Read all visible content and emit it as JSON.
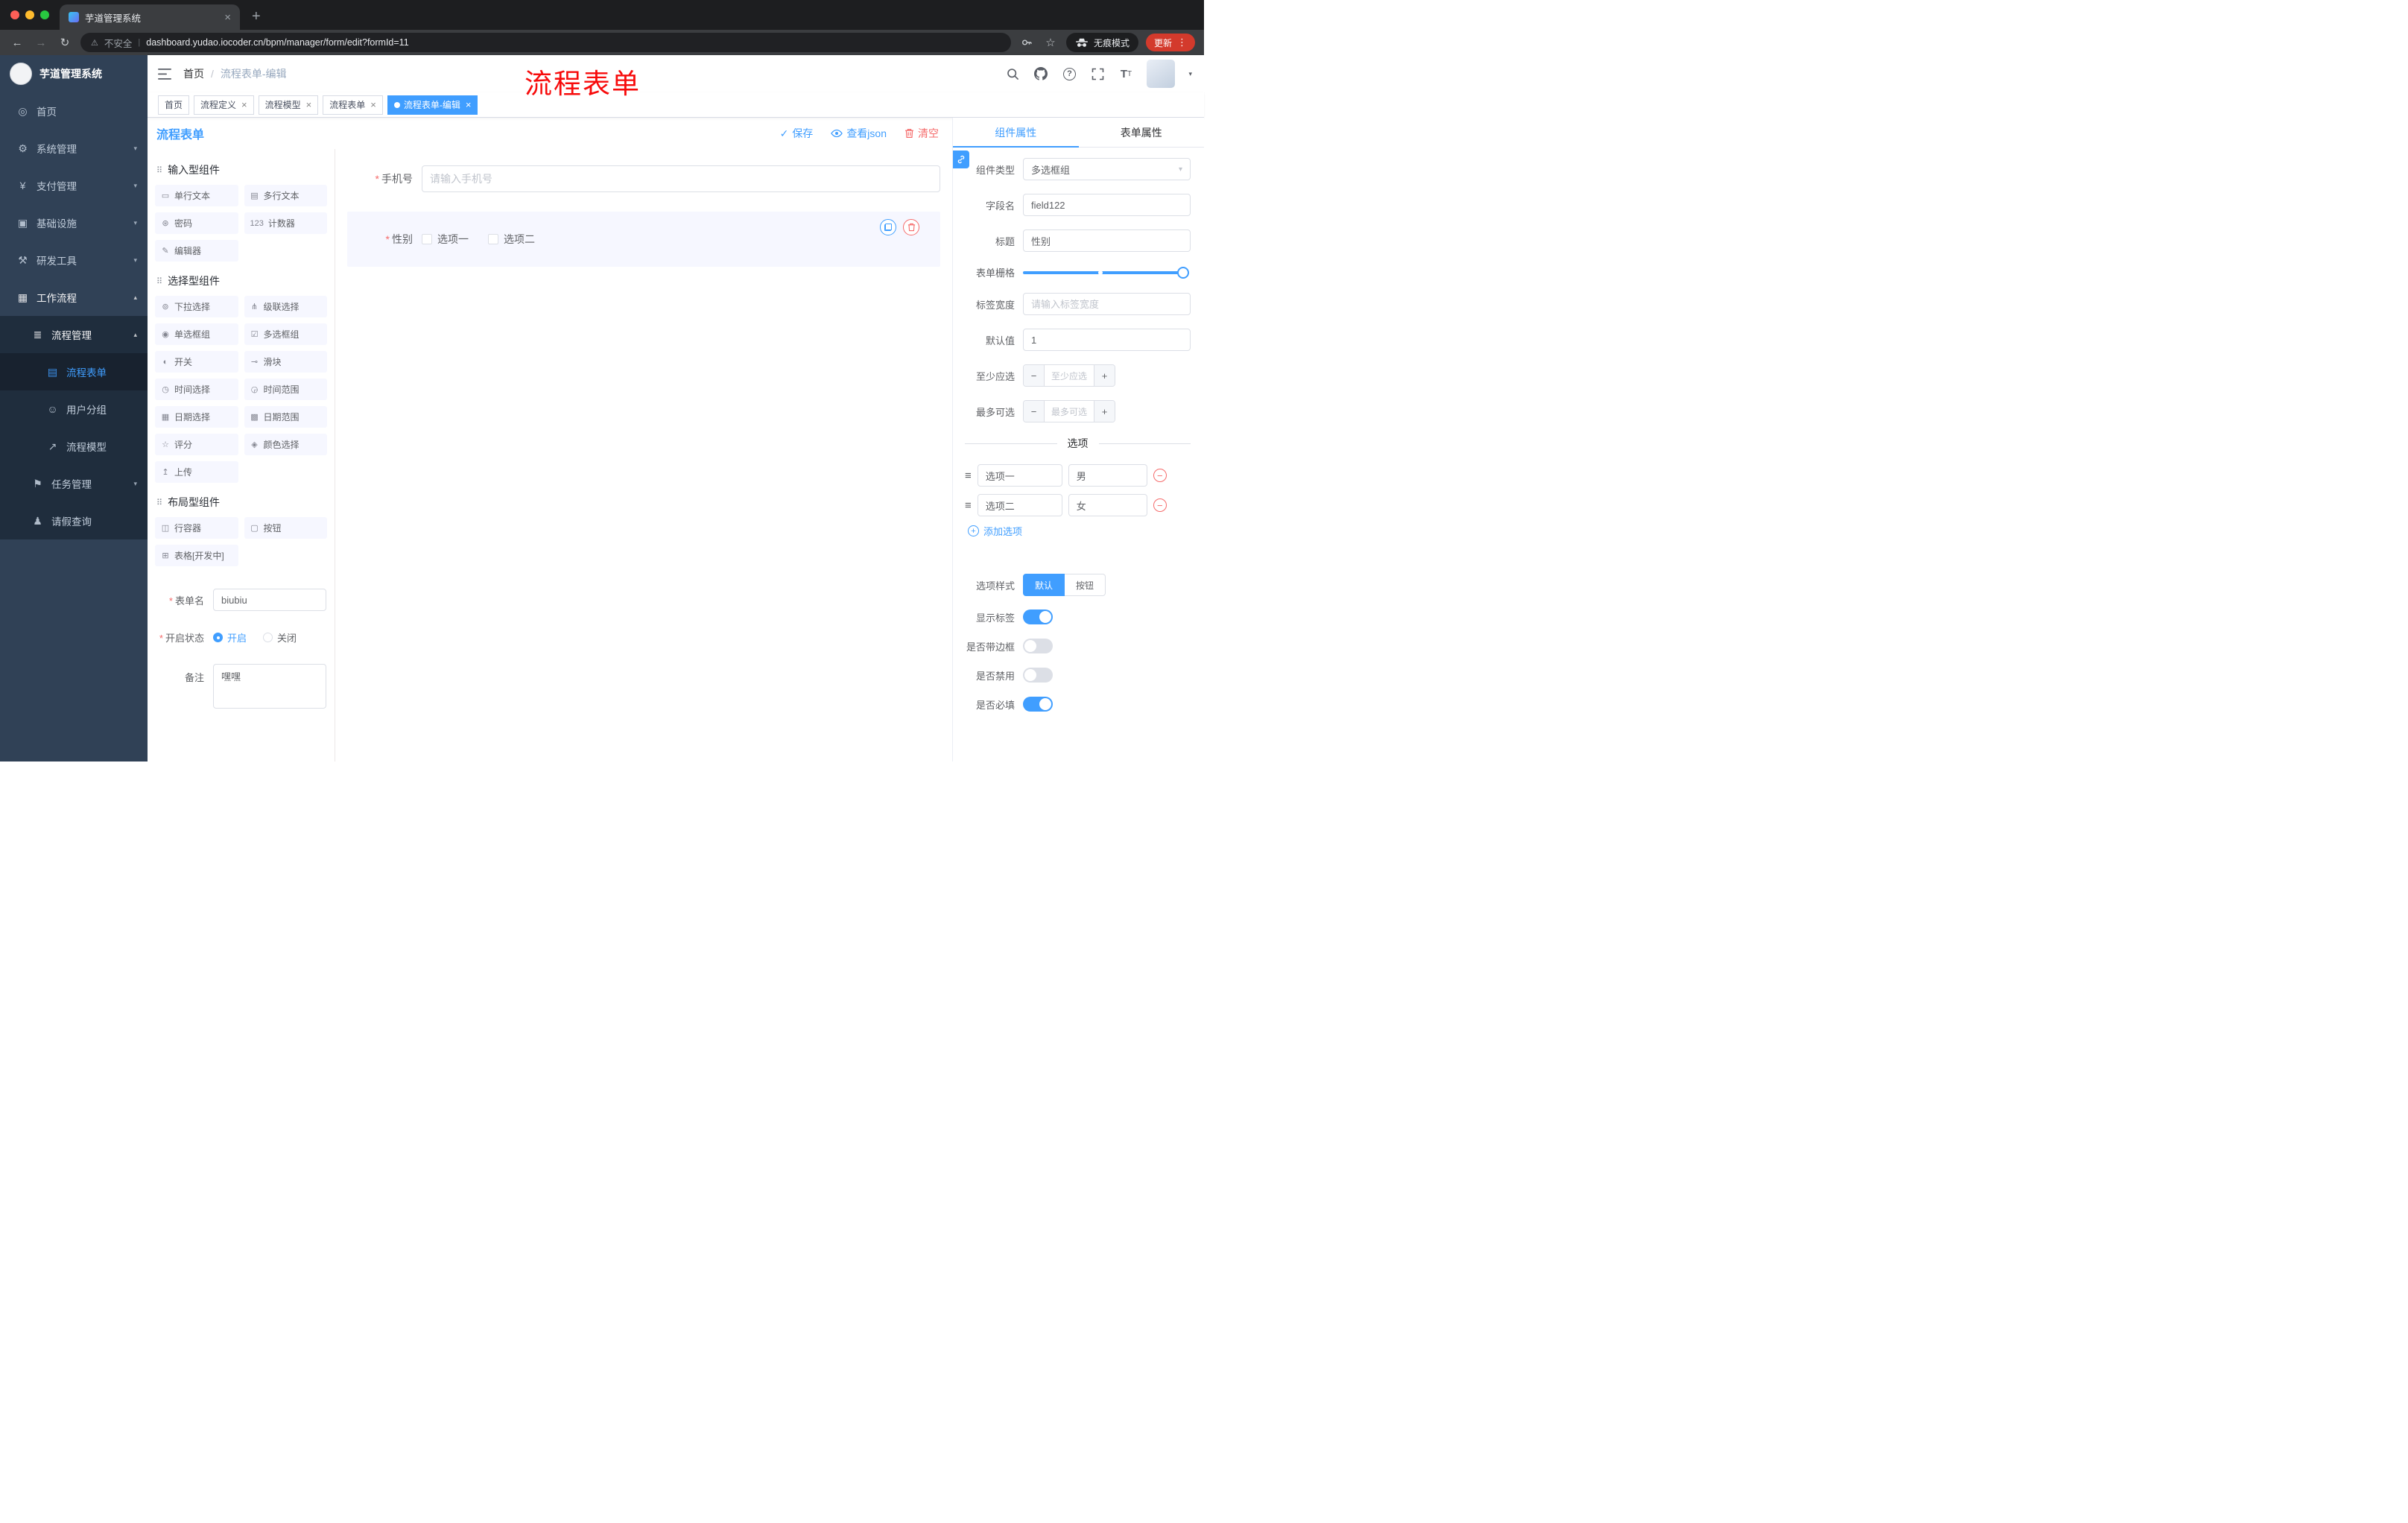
{
  "colors": {
    "primary": "#409eff",
    "danger": "#f56c6c",
    "annotation": "#f70b0b",
    "sidebar-bg": "#304156",
    "submenu-bg": "#1f2d3d",
    "update-badge": "#d33a2c"
  },
  "browser": {
    "tab_title": "芋道管理系统",
    "security_label": "不安全",
    "url": "dashboard.yudao.iocoder.cn/bpm/manager/form/edit?formId=11",
    "incognito_label": "无痕模式",
    "update_label": "更新"
  },
  "sidebar": {
    "logo_title": "芋道管理系统",
    "items": [
      {
        "label": "首页",
        "icon": "home-icon",
        "glyph": "◎",
        "level": 1
      },
      {
        "label": "系统管理",
        "icon": "gear-icon",
        "glyph": "⚙",
        "level": 1,
        "arrow": "▾"
      },
      {
        "label": "支付管理",
        "icon": "payment-icon",
        "glyph": "¥",
        "level": 1,
        "arrow": "▾"
      },
      {
        "label": "基础设施",
        "icon": "infrastructure-icon",
        "glyph": "▣",
        "level": 1,
        "arrow": "▾"
      },
      {
        "label": "研发工具",
        "icon": "dev-tools-icon",
        "glyph": "⚒",
        "level": 1,
        "arrow": "▾"
      },
      {
        "label": "工作流程",
        "icon": "workflow-icon",
        "glyph": "▦",
        "level": 1,
        "arrow": "▴",
        "open": true
      },
      {
        "label": "流程管理",
        "icon": "process-management-icon",
        "glyph": "≣",
        "level": 2,
        "arrow": "▴",
        "open": true,
        "sub": true
      },
      {
        "label": "流程表单",
        "icon": "process-form-icon",
        "glyph": "▤",
        "level": 3,
        "active": true,
        "sub": true
      },
      {
        "label": "用户分组",
        "icon": "user-group-icon",
        "glyph": "☺",
        "level": 3,
        "sub": true
      },
      {
        "label": "流程模型",
        "icon": "process-model-icon",
        "glyph": "↗",
        "level": 3,
        "sub": true
      },
      {
        "label": "任务管理",
        "icon": "task-management-icon",
        "glyph": "⚑",
        "level": 2,
        "arrow": "▾",
        "sub": true
      },
      {
        "label": "请假查询",
        "icon": "leave-query-icon",
        "glyph": "♟",
        "level": 2,
        "sub": true
      }
    ]
  },
  "header": {
    "breadcrumb": [
      "首页",
      "流程表单-编辑"
    ],
    "breadcrumb_sep": "/",
    "annotation": "流程表单"
  },
  "tags": [
    {
      "label": "首页"
    },
    {
      "label": "流程定义",
      "closable": true
    },
    {
      "label": "流程模型",
      "closable": true
    },
    {
      "label": "流程表单",
      "closable": true
    },
    {
      "label": "流程表单-编辑",
      "closable": true,
      "active": true
    }
  ],
  "designer": {
    "panel_title": "流程表单",
    "toolbar": [
      {
        "label": "保存",
        "icon": "check-icon"
      },
      {
        "label": "查看json",
        "icon": "eye-icon"
      },
      {
        "label": "清空",
        "icon": "trash-icon"
      }
    ],
    "palette": {
      "group_icon": "⠿",
      "groups": [
        {
          "title": "输入型组件",
          "items": [
            {
              "label": "单行文本",
              "icon": "single-line-text-icon",
              "glyph": "▭"
            },
            {
              "label": "多行文本",
              "icon": "multi-line-text-icon",
              "glyph": "▤"
            },
            {
              "label": "密码",
              "icon": "password-lock-icon",
              "glyph": "⊛"
            },
            {
              "label": "计数器",
              "icon": "counter-icon",
              "glyph": "123"
            },
            {
              "label": "编辑器",
              "icon": "editor-icon",
              "glyph": "✎"
            }
          ]
        },
        {
          "title": "选择型组件",
          "items": [
            {
              "label": "下拉选择",
              "icon": "select-icon",
              "glyph": "⊚"
            },
            {
              "label": "级联选择",
              "icon": "cascader-icon",
              "glyph": "⋔"
            },
            {
              "label": "单选框组",
              "icon": "radio-group-icon",
              "glyph": "◉"
            },
            {
              "label": "多选框组",
              "icon": "checkbox-group-icon",
              "glyph": "☑"
            },
            {
              "label": "开关",
              "icon": "switch-icon",
              "glyph": "◐"
            },
            {
              "label": "滑块",
              "icon": "slider-icon",
              "glyph": "⊸"
            },
            {
              "label": "时间选择",
              "icon": "time-picker-icon",
              "glyph": "◷"
            },
            {
              "label": "时间范围",
              "icon": "time-range-icon",
              "glyph": "◶"
            },
            {
              "label": "日期选择",
              "icon": "date-picker-icon",
              "glyph": "▦"
            },
            {
              "label": "日期范围",
              "icon": "date-range-icon",
              "glyph": "▩"
            },
            {
              "label": "评分",
              "icon": "rate-icon",
              "glyph": "☆"
            },
            {
              "label": "颜色选择",
              "icon": "color-picker-icon",
              "glyph": "◈"
            },
            {
              "label": "上传",
              "icon": "upload-icon",
              "glyph": "↥"
            }
          ]
        },
        {
          "title": "布局型组件",
          "items": [
            {
              "label": "行容器",
              "icon": "row-container-icon",
              "glyph": "◫"
            },
            {
              "label": "按钮",
              "icon": "button-icon",
              "glyph": "▢"
            },
            {
              "label": "表格[开发中]",
              "icon": "table-icon",
              "glyph": "⊞"
            }
          ]
        }
      ],
      "form": {
        "name_label": "表单名",
        "name_value": "biubiu",
        "status_label": "开启状态",
        "status_on": "开启",
        "status_off": "关闭",
        "remark_label": "备注",
        "remark_value": "嘿嘿"
      }
    },
    "canvas": {
      "phone_label": "手机号",
      "phone_placeholder": "请输入手机号",
      "gender_label": "性别",
      "gender_options": [
        "选项一",
        "选项二"
      ]
    }
  },
  "inspector": {
    "tabs": [
      {
        "label": "组件属性",
        "active": true
      },
      {
        "label": "表单属性"
      }
    ],
    "rows": {
      "component_type": {
        "label": "组件类型",
        "value": "多选框组"
      },
      "field_name": {
        "label": "字段名",
        "value": "field122"
      },
      "title": {
        "label": "标题",
        "value": "性别"
      },
      "grid": {
        "label": "表单栅格"
      },
      "label_width": {
        "label": "标签宽度",
        "placeholder": "请输入标签宽度"
      },
      "default": {
        "label": "默认值",
        "value": "1"
      },
      "min": {
        "label": "至少应选",
        "placeholder": "至少应选"
      },
      "max": {
        "label": "最多可选",
        "placeholder": "最多可选"
      }
    },
    "stepper_minus": "−",
    "stepper_plus": "+",
    "options_divider": "选项",
    "options": [
      {
        "label": "选项一",
        "value": "男"
      },
      {
        "label": "选项二",
        "value": "女"
      }
    ],
    "add_option_label": "添加选项",
    "option_style": {
      "label": "选项样式",
      "options": [
        {
          "label": "默认",
          "active": true
        },
        {
          "label": "按钮"
        }
      ]
    },
    "switches": [
      {
        "label": "显示标签",
        "on": true
      },
      {
        "label": "是否带边框",
        "on": false
      },
      {
        "label": "是否禁用",
        "on": false
      },
      {
        "label": "是否必填",
        "on": true
      }
    ]
  }
}
